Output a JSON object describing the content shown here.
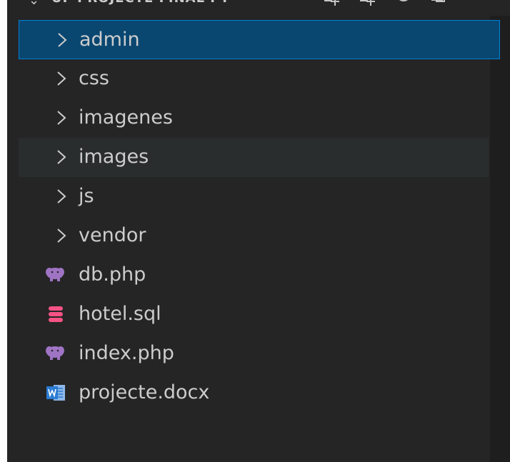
{
  "explorer": {
    "title": "UF PROJECTE FINAL PT",
    "actions": [
      "new-file-icon",
      "new-folder-icon",
      "refresh-icon",
      "collapse-all-icon"
    ]
  },
  "tree": {
    "items": [
      {
        "label": "admin",
        "type": "folder",
        "state": "selected"
      },
      {
        "label": "css",
        "type": "folder"
      },
      {
        "label": "imagenes",
        "type": "folder"
      },
      {
        "label": "images",
        "type": "folder",
        "state": "hover"
      },
      {
        "label": "js",
        "type": "folder"
      },
      {
        "label": "vendor",
        "type": "folder"
      },
      {
        "label": "db.php",
        "type": "file",
        "icon": "php-elephant-icon"
      },
      {
        "label": "hotel.sql",
        "type": "file",
        "icon": "database-icon"
      },
      {
        "label": "index.php",
        "type": "file",
        "icon": "php-elephant-icon"
      },
      {
        "label": "projecte.docx",
        "type": "file",
        "icon": "word-document-icon"
      }
    ]
  },
  "colors": {
    "background": "#252526",
    "selection": "#094771",
    "selection_border": "#007fd4",
    "hover": "#2a2d2e",
    "text": "#cccccc",
    "php_icon": "#a074c4",
    "sql_icon": "#f55385",
    "word_icon": "#2b7cd3"
  }
}
